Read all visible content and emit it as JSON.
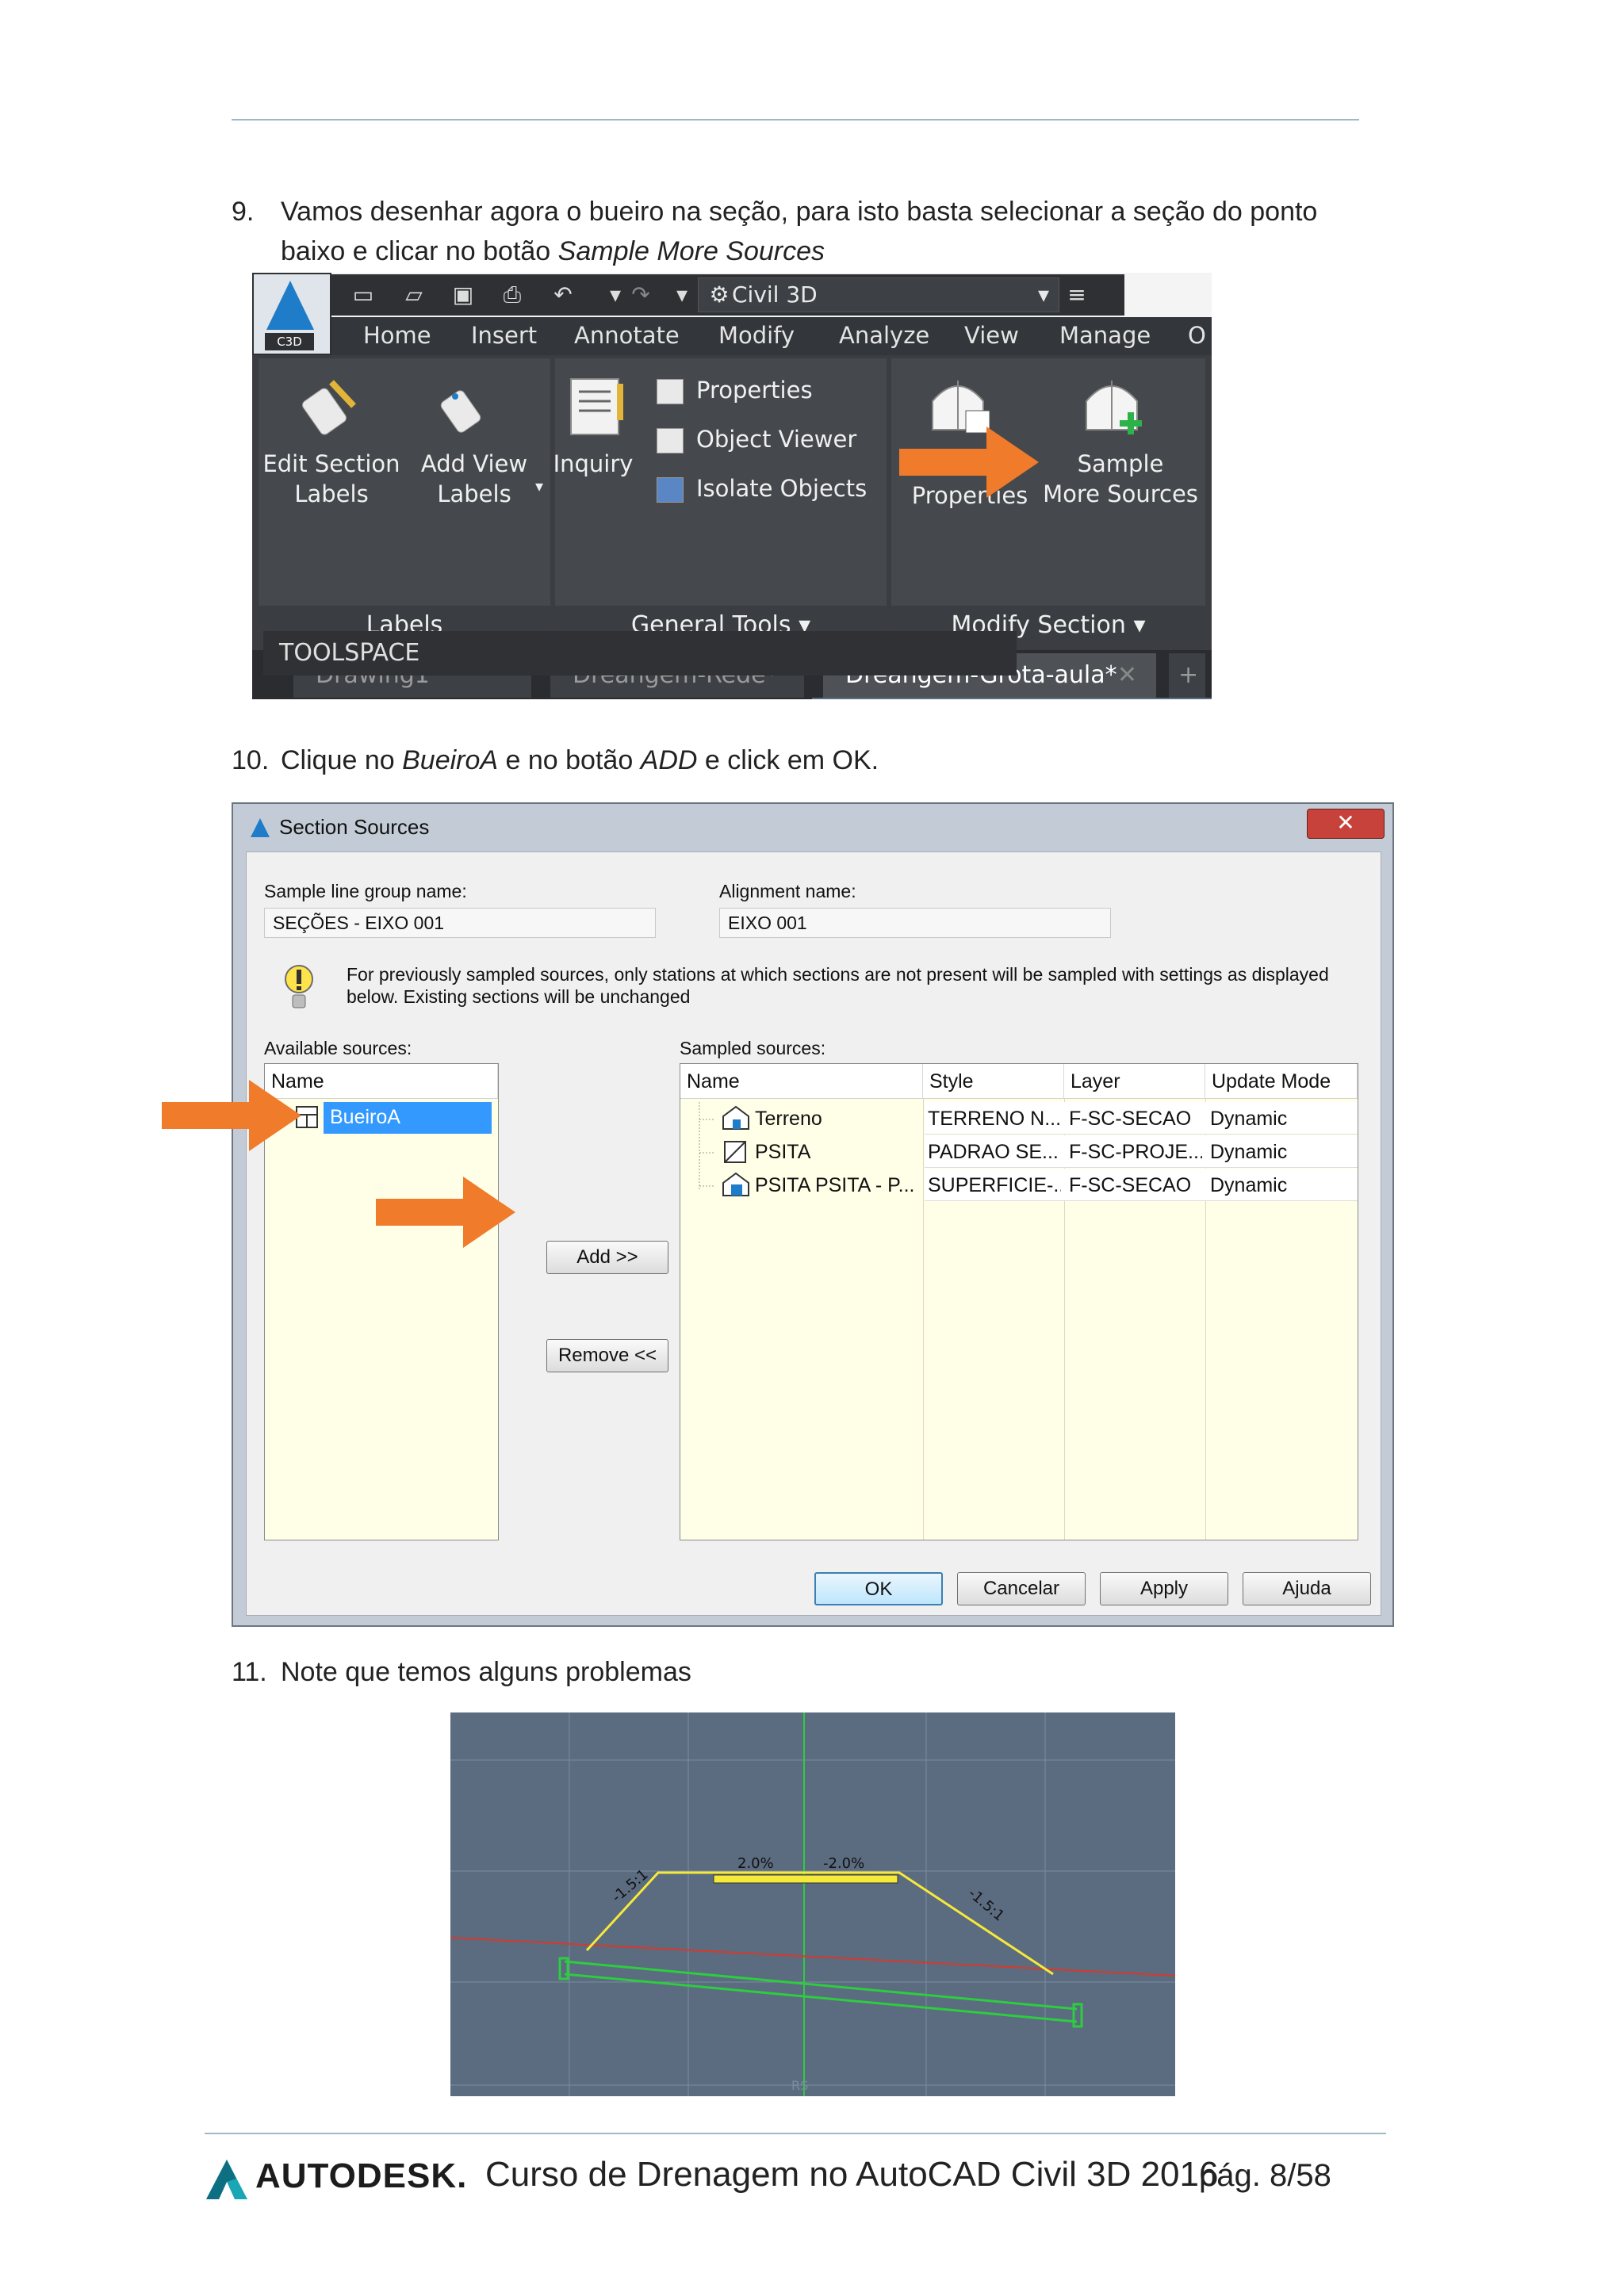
{
  "step9": {
    "number": "9.",
    "line1": "Vamos desenhar agora o bueiro na seção, para isto basta selecionar a seção do ponto",
    "line2_prefix": "baixo e clicar no botão ",
    "line2_emph": "Sample More Sources"
  },
  "ribbon": {
    "logo_badge": "C3D",
    "workspace": "Civil 3D",
    "tabs": [
      "Home",
      "Insert",
      "Annotate",
      "Modify",
      "Analyze",
      "View",
      "Manage",
      "O"
    ],
    "labels_panel": {
      "edit_section_labels": [
        "Edit Section",
        "Labels"
      ],
      "add_view_labels": [
        "Add View",
        "Labels"
      ],
      "title": "Labels"
    },
    "general_tools": {
      "inquiry": "Inquiry",
      "properties": "Properties",
      "object_viewer": "Object Viewer",
      "isolate_objects": "Isolate Objects",
      "title": "General Tools"
    },
    "modify_section": {
      "properties": "Properties",
      "sample_more_sources": [
        "Sample",
        "More Sources"
      ],
      "title": "Modify Section"
    },
    "doc_tabs": [
      "Drawing1",
      "Dreangem-Rede*",
      "Dreangem-Grota-aula*"
    ],
    "toolspace": "TOOLSPACE"
  },
  "step10": {
    "number": "10.",
    "prefix": "Clique no ",
    "emph1": "BueiroA",
    "mid": " e no botão ",
    "emph2": "ADD",
    "suffix": " e click em OK."
  },
  "dialog": {
    "title": "Section Sources",
    "close": "✕",
    "sample_line_group_label": "Sample line group name:",
    "sample_line_group_value": "SEÇÕES - EIXO 001",
    "alignment_label": "Alignment name:",
    "alignment_value": "EIXO 001",
    "info_line1": "For previously sampled sources, only stations at which sections are not present will be sampled with settings as displayed",
    "info_line2": "below. Existing sections will be unchanged",
    "available_label": "Available sources:",
    "available_header": "Name",
    "available_items": [
      "BueiroA"
    ],
    "sampled_label": "Sampled sources:",
    "sampled_headers": [
      "Name",
      "Style",
      "Layer",
      "Update Mode"
    ],
    "sampled_rows": [
      {
        "name": "Terreno",
        "style": "TERRENO N...",
        "layer": "F-SC-SECAO",
        "mode": "Dynamic"
      },
      {
        "name": "PSITA",
        "style": "PADRAO SE...",
        "layer": "F-SC-PROJE...",
        "mode": "Dynamic"
      },
      {
        "name": "PSITA PSITA - P...",
        "style": "SUPERFICIE-...",
        "layer": "F-SC-SECAO",
        "mode": "Dynamic"
      }
    ],
    "add_button": "Add >>",
    "remove_button": "Remove <<",
    "ok_button": "OK",
    "cancel_button": "Cancelar",
    "apply_button": "Apply",
    "help_button": "Ajuda"
  },
  "step11": {
    "number": "11.",
    "text": "Note que temos alguns problemas"
  },
  "section_view": {
    "slope_left": "-1.5:1",
    "slope_right": "-1.5:1",
    "grade_left": "2.0%",
    "grade_right": "-2.0%",
    "bottom_label": "RS"
  },
  "footer": {
    "brand": "AUTODESK.",
    "course": "Curso de Drenagem no AutoCAD Civil 3D 2016",
    "page": "pág. 8/58"
  },
  "colors": {
    "rule": "#9fb8c8",
    "ribbon_dark": "#3b3d40",
    "arrow_orange": "#f07b2b",
    "section_bg": "#5b6b80",
    "autodesk_teal": "#1aa7b5"
  }
}
